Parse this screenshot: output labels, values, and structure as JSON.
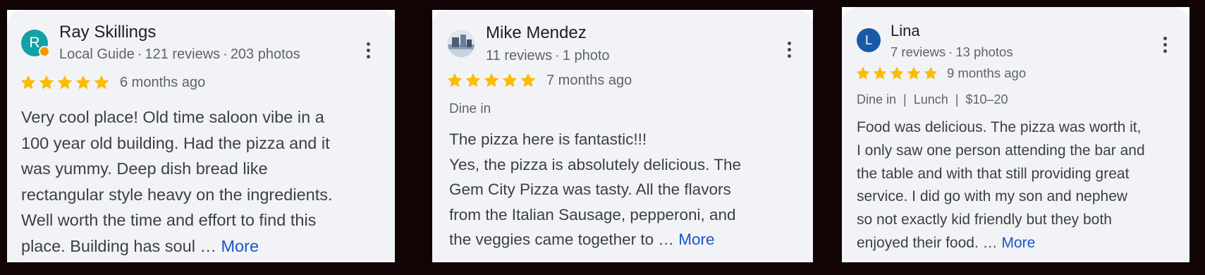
{
  "colors": {
    "background": "#120305",
    "card": "#f2f3f6",
    "star": "#fbbc04",
    "link": "#1a56c8",
    "badge": "#f29900"
  },
  "reviews": [
    {
      "avatar": {
        "letter": "R",
        "color": "#12a1a6",
        "has_badge": true
      },
      "name": "Ray Skillings",
      "meta": [
        "Local Guide",
        "121 reviews",
        "203 photos"
      ],
      "rating": 5,
      "time_ago": "6 months ago",
      "tags": [],
      "text": [
        "Very cool place! Old time saloon vibe in a",
        "100 year old building. Had the pizza and it",
        "was yummy. Deep dish bread like",
        "rectangular style heavy on the ingredients.",
        "Well worth the time and effort to find this",
        "place. Building has soul …"
      ],
      "more": "More"
    },
    {
      "avatar": {
        "letter": "",
        "color": "#7f94ad",
        "photo": true
      },
      "name": "Mike Mendez",
      "meta": [
        "11 reviews",
        "1 photo"
      ],
      "rating": 5,
      "time_ago": "7 months ago",
      "tags": [
        "Dine in"
      ],
      "text": [
        "The pizza here is fantastic!!!",
        "Yes, the pizza is absolutely delicious. The",
        "Gem City Pizza was tasty. All the flavors",
        "from the Italian Sausage, pepperoni, and",
        "the veggies came together to …"
      ],
      "more": "More"
    },
    {
      "avatar": {
        "letter": "L",
        "color": "#1a58a8",
        "has_badge": false
      },
      "name": "Lina",
      "meta": [
        "7 reviews",
        "13 photos"
      ],
      "rating": 5,
      "time_ago": "9 months ago",
      "tags": [
        "Dine in",
        "Lunch",
        "$10–20"
      ],
      "text": [
        "Food was delicious. The pizza was worth it,",
        "I only saw one person attending the bar and",
        "the table and with that still providing great",
        "service. I did go with my son and nephew",
        "so not exactly kid friendly but they both",
        "enjoyed their food. …"
      ],
      "more": "More"
    }
  ]
}
